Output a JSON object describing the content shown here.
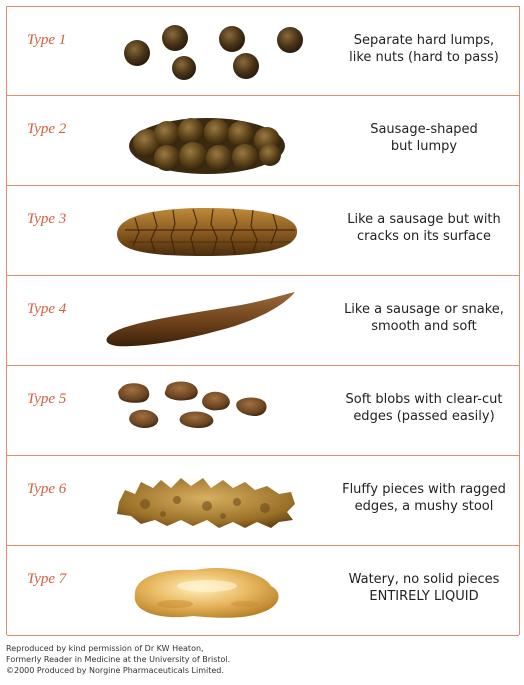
{
  "rows": [
    {
      "type": "Type 1",
      "line1": "Separate hard lumps,",
      "line2": "like nuts (hard to pass)"
    },
    {
      "type": "Type 2",
      "line1": "Sausage-shaped",
      "line2": "but lumpy"
    },
    {
      "type": "Type 3",
      "line1": "Like a sausage but with",
      "line2": "cracks on its surface"
    },
    {
      "type": "Type 4",
      "line1": "Like a sausage or snake,",
      "line2": "smooth and soft"
    },
    {
      "type": "Type 5",
      "line1": "Soft blobs with clear-cut",
      "line2": "edges (passed easily)"
    },
    {
      "type": "Type 6",
      "line1": "Fluffy pieces with ragged",
      "line2": "edges, a mushy stool"
    },
    {
      "type": "Type 7",
      "line1": "Watery, no solid pieces",
      "line2": "ENTIRELY LIQUID"
    }
  ],
  "credits": {
    "line1": "Reproduced by kind permission of Dr KW Heaton,",
    "line2": "Formerly Reader in Medicine at the University of Bristol.",
    "line3": "©2000 Produced by Norgine Pharmaceuticals Limited."
  },
  "colors": {
    "border": "#e58c6f",
    "type_label": "#d2603f",
    "stool_dark": "#5a3a1a",
    "stool_mid": "#8a5a28",
    "stool_light": "#c89a50",
    "liquid": "#e8b860"
  }
}
